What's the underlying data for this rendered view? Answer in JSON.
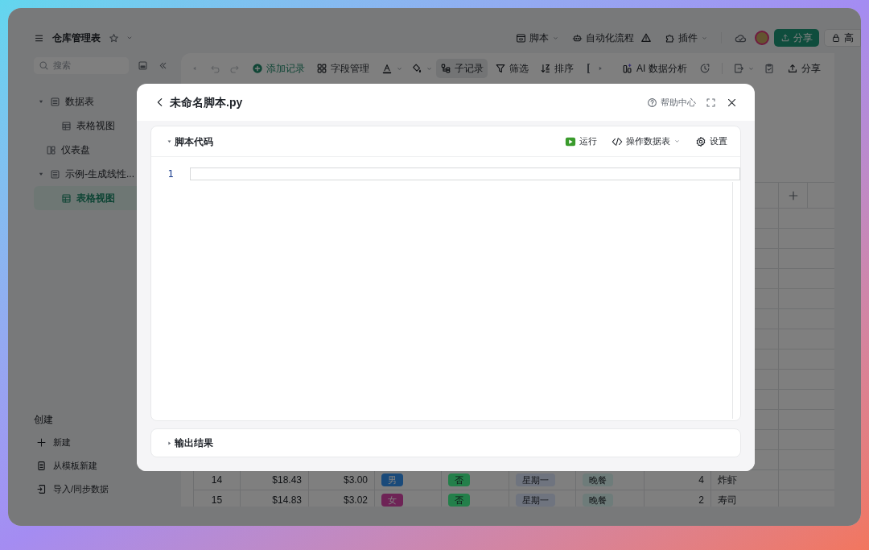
{
  "header": {
    "title": "仓库管理表",
    "menus": [
      {
        "label": "脚本",
        "kind": "script"
      },
      {
        "label": "自动化流程",
        "kind": "automation"
      },
      {
        "label": "插件",
        "kind": "plugin"
      }
    ],
    "share_button": "分享",
    "lock_button": "高"
  },
  "sidebar": {
    "search": {
      "placeholder": "搜索"
    },
    "tree": [
      {
        "label": "数据表",
        "kind": "table",
        "expanded": true,
        "selected": false,
        "children": [
          {
            "label": "表格视图",
            "kind": "grid",
            "selected": false
          }
        ]
      },
      {
        "label": "仪表盘",
        "kind": "dashboard",
        "selected": false
      },
      {
        "label": "示例-生成线性...",
        "kind": "table",
        "expanded": true,
        "selected": false,
        "children": [
          {
            "label": "表格视图",
            "kind": "grid",
            "selected": true
          }
        ]
      }
    ],
    "create": {
      "title": "创建",
      "items": [
        {
          "label": "新建",
          "kind": "plus"
        },
        {
          "label": "从模板新建",
          "kind": "template"
        },
        {
          "label": "导入/同步数据",
          "kind": "import"
        }
      ]
    }
  },
  "toolbar": {
    "items": [
      {
        "label": "添加记录",
        "kind": "add",
        "selected": false
      },
      {
        "label": "字段管理",
        "kind": "fields",
        "selected": false
      },
      {
        "label": "子记录",
        "kind": "subrecord",
        "selected": true
      },
      {
        "label": "筛选",
        "kind": "filter",
        "selected": false
      },
      {
        "label": "排序",
        "kind": "sort",
        "selected": false
      },
      {
        "label": "AI 数据分析",
        "kind": "ai",
        "selected": false
      },
      {
        "label": "分享",
        "kind": "share",
        "selected": false
      }
    ]
  },
  "table": {
    "rows": [
      {
        "cells": [
          {
            "text": "14"
          },
          {
            "text": "$18.43"
          },
          {
            "text": "$3.00"
          },
          {
            "text": "男",
            "color": "#1a4a7a"
          },
          {
            "text": "否",
            "color": "#23804a"
          },
          {
            "text": "星期一",
            "color": "#6f7480"
          },
          {
            "text": "晚餐",
            "color": "#6e7c7a"
          },
          {
            "text": "4"
          },
          {
            "text": "炸虾"
          }
        ]
      },
      {
        "cells": [
          {
            "text": "15"
          },
          {
            "text": "$14.83"
          },
          {
            "text": "$3.02"
          },
          {
            "text": "女",
            "color": "#6e2356"
          },
          {
            "text": "否",
            "color": "#23804a"
          },
          {
            "text": "星期一",
            "color": "#6f7480"
          },
          {
            "text": "晚餐",
            "color": "#6e7c7a"
          },
          {
            "text": "2"
          },
          {
            "text": "寿司"
          }
        ]
      }
    ]
  },
  "modal": {
    "title": "未命名脚本.py",
    "help": "帮助中心",
    "code_panel": {
      "title": "脚本代码",
      "expanded": true,
      "actions": [
        {
          "label": "运行",
          "kind": "run"
        },
        {
          "label": "操作数据表",
          "kind": "table-op"
        },
        {
          "label": "设置",
          "kind": "settings"
        }
      ],
      "line_numbers": [
        "1"
      ]
    },
    "output_panel": {
      "title": "输出结果",
      "expanded": false
    }
  }
}
